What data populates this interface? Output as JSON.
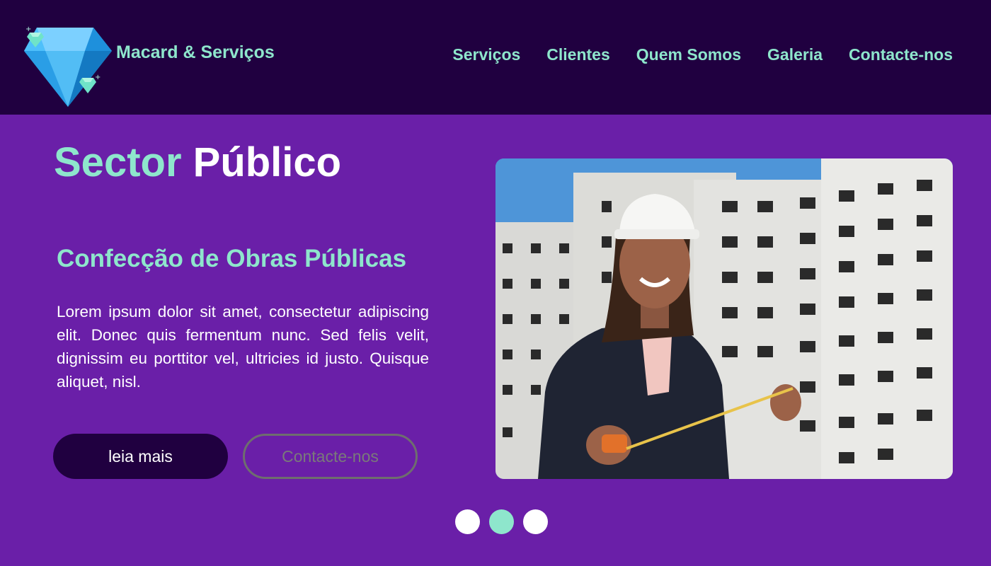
{
  "header": {
    "brand": "Macard & Serviços",
    "nav": [
      "Serviços",
      "Clientes",
      "Quem Somos",
      "Galeria",
      "Contacte-nos"
    ]
  },
  "hero": {
    "title_part1": "Sector",
    "title_part2": "Público",
    "subtitle": "Confecção de Obras Públicas",
    "body": "Lorem ipsum dolor sit amet, consectetur adipiscing elit. Donec quis fermentum nunc. Sed felis velit, dignissim eu porttitor vel, ultricies id justo. Quisque aliquet, nisl.",
    "primary_button": "leia mais",
    "secondary_button": "Contacte-nos"
  },
  "carousel": {
    "count": 3,
    "active_index": 1
  },
  "colors": {
    "header_bg": "#200040",
    "page_bg": "#6a1fa8",
    "accent": "#8ee6cc"
  }
}
